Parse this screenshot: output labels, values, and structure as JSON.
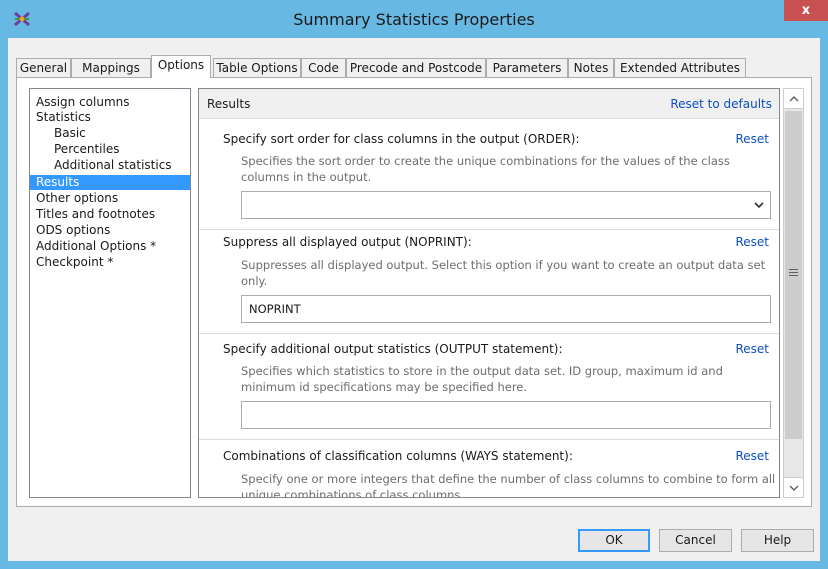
{
  "window": {
    "title": "Summary Statistics Properties",
    "close_label": "x"
  },
  "tabs": [
    {
      "label": "General",
      "active": false
    },
    {
      "label": "Mappings",
      "active": false
    },
    {
      "label": "Options",
      "active": true
    },
    {
      "label": "Table Options",
      "active": false
    },
    {
      "label": "Code",
      "active": false
    },
    {
      "label": "Precode and Postcode",
      "active": false
    },
    {
      "label": "Parameters",
      "active": false
    },
    {
      "label": "Notes",
      "active": false
    },
    {
      "label": "Extended Attributes",
      "active": false
    }
  ],
  "nav": {
    "items": [
      {
        "label": "Assign columns",
        "indent": false,
        "selected": false
      },
      {
        "label": "Statistics",
        "indent": false,
        "selected": false
      },
      {
        "label": "Basic",
        "indent": true,
        "selected": false
      },
      {
        "label": "Percentiles",
        "indent": true,
        "selected": false
      },
      {
        "label": "Additional statistics",
        "indent": true,
        "selected": false
      },
      {
        "label": "Results",
        "indent": false,
        "selected": true
      },
      {
        "label": "Other options",
        "indent": false,
        "selected": false
      },
      {
        "label": "Titles and footnotes",
        "indent": false,
        "selected": false
      },
      {
        "label": "ODS options",
        "indent": false,
        "selected": false
      },
      {
        "label": "Additional Options *",
        "indent": false,
        "selected": false
      },
      {
        "label": "Checkpoint *",
        "indent": false,
        "selected": false
      }
    ]
  },
  "content": {
    "section_title": "Results",
    "reset_defaults": "Reset to defaults",
    "options": [
      {
        "label": "Specify sort order for class columns in the output (ORDER):",
        "reset": "Reset",
        "description": "Specifies the sort order to create the unique combinations for the values of the class columns in the output.",
        "value": "",
        "is_dropdown": true
      },
      {
        "label": "Suppress all displayed output (NOPRINT):",
        "reset": "Reset",
        "description": "Suppresses all displayed output.  Select this option if you want to create an output data set only.",
        "value": "NOPRINT",
        "is_dropdown": false
      },
      {
        "label": "Specify additional output statistics (OUTPUT statement):",
        "reset": "Reset",
        "description": "Specifies which statistics to store in the output data set. ID group, maximum id and minimum id specifications may be specified here.",
        "value": "",
        "is_dropdown": false
      },
      {
        "label": "Combinations of classification columns (WAYS statement):",
        "reset": "Reset",
        "description": "Specify one or more integers that define the number of class columns to combine to form all unique combinations of class columns.",
        "value": "",
        "is_dropdown": false
      }
    ]
  },
  "buttons": {
    "ok": "OK",
    "cancel": "Cancel",
    "help": "Help"
  },
  "colors": {
    "title_bar": "#67b8e3",
    "selection": "#3399ff",
    "link": "#0a4fc2",
    "close_button": "#c75050"
  }
}
